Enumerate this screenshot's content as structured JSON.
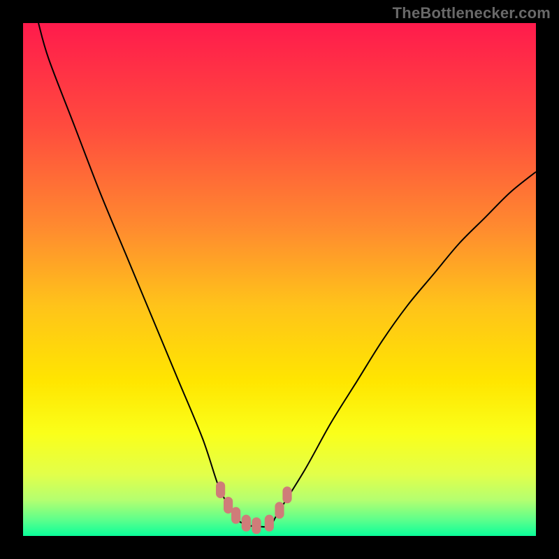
{
  "watermark": {
    "text": "TheBottlenecker.com"
  },
  "chart_data": {
    "type": "line",
    "title": "",
    "xlabel": "",
    "ylabel": "",
    "xlim": [
      0,
      100
    ],
    "ylim": [
      0,
      100
    ],
    "x": [
      3,
      5,
      10,
      15,
      20,
      25,
      30,
      35,
      38,
      40,
      42,
      44,
      45,
      48,
      50,
      55,
      60,
      65,
      70,
      75,
      80,
      85,
      90,
      95,
      100
    ],
    "values": [
      100,
      93,
      80,
      67,
      55,
      43,
      31,
      19,
      10,
      6,
      3,
      2,
      2,
      2,
      5,
      13,
      22,
      30,
      38,
      45,
      51,
      57,
      62,
      67,
      71
    ],
    "markers": {
      "x": [
        38.5,
        40,
        41.5,
        43.5,
        45.5,
        48,
        50,
        51.5
      ],
      "y": [
        9,
        6,
        4,
        2.5,
        2,
        2.5,
        5,
        8
      ]
    },
    "marker_style": {
      "color": "#cf7c79",
      "size": 12,
      "shape": "rounded-rect"
    },
    "line_style": {
      "color": "#000000",
      "width": 2
    },
    "background_gradient": {
      "stops": [
        {
          "offset": 0.0,
          "color": "#ff1b4c"
        },
        {
          "offset": 0.2,
          "color": "#ff4b3e"
        },
        {
          "offset": 0.4,
          "color": "#ff8b2f"
        },
        {
          "offset": 0.55,
          "color": "#ffc31a"
        },
        {
          "offset": 0.7,
          "color": "#ffe600"
        },
        {
          "offset": 0.8,
          "color": "#faff1a"
        },
        {
          "offset": 0.88,
          "color": "#e2ff4a"
        },
        {
          "offset": 0.93,
          "color": "#b4ff70"
        },
        {
          "offset": 0.97,
          "color": "#5aff8c"
        },
        {
          "offset": 1.0,
          "color": "#0aff9a"
        }
      ]
    }
  }
}
